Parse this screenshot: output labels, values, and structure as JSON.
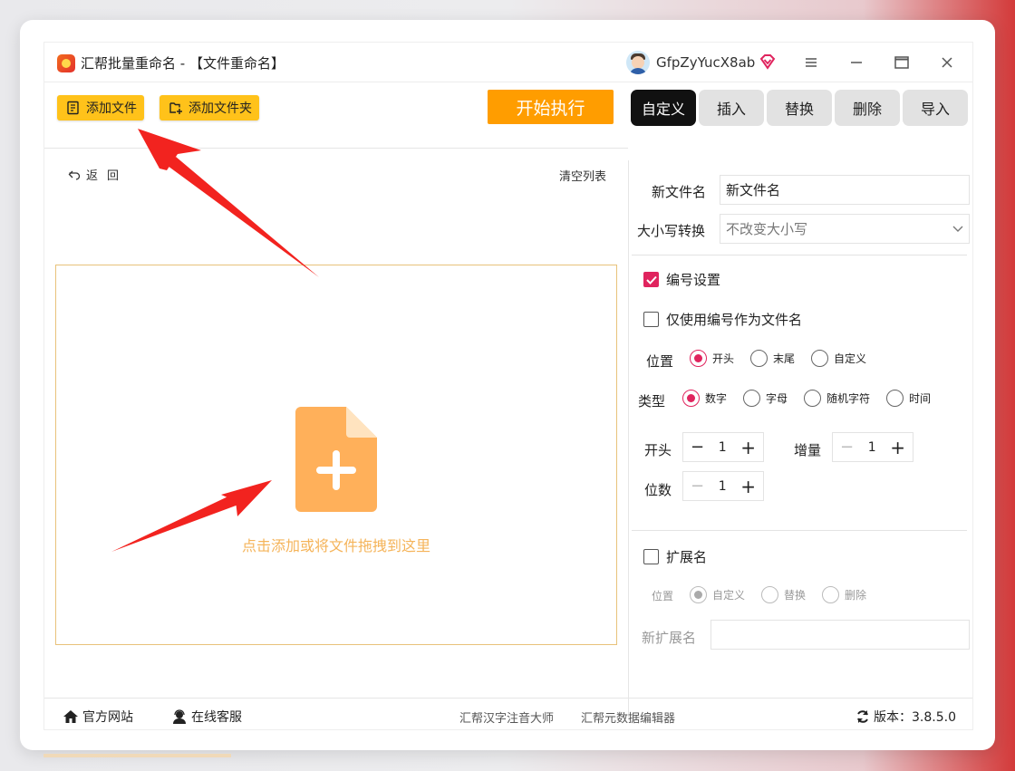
{
  "window": {
    "title": "汇帮批量重命名 - 【文件重命名】",
    "username": "GfpZyYucX8ab"
  },
  "toolbar": {
    "add_file": "添加文件",
    "add_folder": "添加文件夹",
    "start": "开始执行"
  },
  "tabs": [
    {
      "label": "自定义",
      "active": true
    },
    {
      "label": "插入",
      "active": false
    },
    {
      "label": "替换",
      "active": false
    },
    {
      "label": "删除",
      "active": false
    },
    {
      "label": "导入",
      "active": false
    }
  ],
  "list": {
    "back": "返回",
    "clear": "清空列表",
    "drop_hint": "点击添加或将文件拖拽到这里"
  },
  "settings": {
    "new_name_label": "新文件名",
    "new_name_value": "新文件名",
    "case_label": "大小写转换",
    "case_value": "不改变大小写",
    "numbering_label": "编号设置",
    "numbering_checked": true,
    "only_number_label": "仅使用编号作为文件名",
    "only_number_checked": false,
    "position_label": "位置",
    "position_options": [
      "开头",
      "末尾",
      "自定义"
    ],
    "position_selected": "开头",
    "type_label": "类型",
    "type_options": [
      "数字",
      "字母",
      "随机字符",
      "时间"
    ],
    "type_selected": "数字",
    "start_label": "开头",
    "start_value": "1",
    "increment_label": "增量",
    "increment_value": "1",
    "digits_label": "位数",
    "digits_value": "1",
    "ext_label": "扩展名",
    "ext_checked": false,
    "ext_position_label": "位置",
    "ext_options": [
      "自定义",
      "替换",
      "删除"
    ],
    "ext_selected": "自定义",
    "new_ext_label": "新扩展名",
    "new_ext_value": ""
  },
  "footer": {
    "website": "官方网站",
    "support": "在线客服",
    "link1": "汇帮汉字注音大师",
    "link2": "汇帮元数据编辑器",
    "version": "版本：3.8.5.0"
  },
  "colors": {
    "accent_orange": "#ff9d00",
    "button_yellow": "#ffc21a",
    "check_pink": "#e0245e",
    "arrow_red": "#f2231f"
  }
}
